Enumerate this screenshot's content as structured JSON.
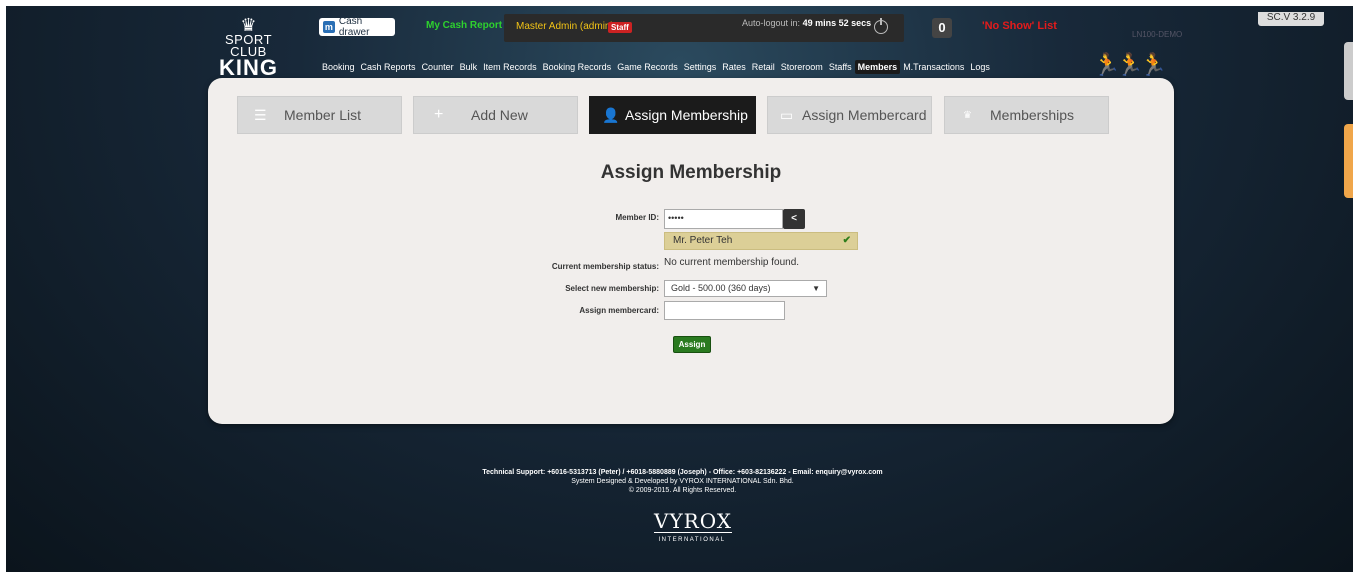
{
  "logo": {
    "line1": "SPORT CLUB",
    "line2": "KING"
  },
  "header": {
    "cash_drawer_label": "Cash drawer",
    "my_cash_report": "My Cash Report",
    "user": "Master Admin (admin)",
    "user_badge": "Staff",
    "autologout_label": "Auto-logout in:",
    "autologout_time": "49 mins 52 secs",
    "count": "0",
    "no_show": "'No Show' List",
    "instance": "LN100-DEMO",
    "version": "SC.V 3.2.9"
  },
  "nav": {
    "items": [
      "Booking",
      "Cash Reports",
      "Counter",
      "Bulk",
      "Item Records",
      "Booking Records",
      "Game Records",
      "Settings",
      "Rates",
      "Retail",
      "Storeroom",
      "Staffs",
      "Members",
      "M.Transactions",
      "Logs"
    ],
    "active": "Members"
  },
  "tabs": [
    {
      "label": "Member List",
      "icon": "list-icon"
    },
    {
      "label": "Add New",
      "icon": "plus-icon"
    },
    {
      "label": "Assign Membership",
      "icon": "user-icon",
      "active": true
    },
    {
      "label": "Assign Membercard",
      "icon": "card-icon"
    },
    {
      "label": "Memberships",
      "icon": "crown-icon"
    }
  ],
  "form": {
    "title": "Assign Membership",
    "member_id_label": "Member ID:",
    "member_id_value": "•••••",
    "back_label": "<",
    "found_name": "Mr. Peter Teh",
    "status_label": "Current membership status:",
    "status_value": "No current membership found.",
    "select_label": "Select new membership:",
    "select_value": "Gold - 500.00 (360 days)",
    "membercard_label": "Assign membercard:",
    "membercard_value": "",
    "assign_button": "Assign"
  },
  "footer": {
    "line1": "Technical Support: +6016-5313713 (Peter) / +6018-5880889 (Joseph) - Office: +603-82136222 - Email: enquiry@vyrox.com",
    "line2": "System Designed & Developed by VYROX INTERNATIONAL Sdn. Bhd.",
    "line3": "© 2009-2015. All Rights Reserved.",
    "brand": "VYROX",
    "brand_sub": "INTERNATIONAL"
  },
  "colors": {
    "accent_green": "#2ed12e",
    "noshow_red": "#e31b1b",
    "assign_green": "#2a7a20"
  }
}
